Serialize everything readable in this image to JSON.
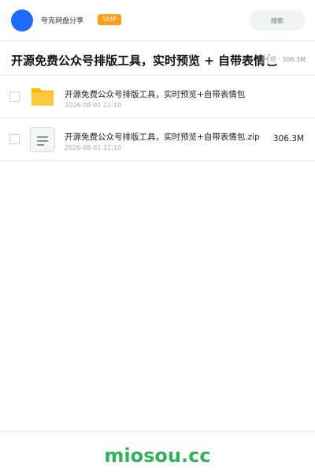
{
  "header": {
    "sharer_name": "夸克网盘分享",
    "badge": "SVIP",
    "search_placeholder": "搜索"
  },
  "share": {
    "title": "开源免费公众号排版工具，实时预览 + 自带表情包",
    "meta": "项 · 306.3M"
  },
  "files": [
    {
      "name": "开源免费公众号排版工具，实时预览+自带表情包",
      "date": "2026-08-01 22:10",
      "size": "",
      "icon": "folder-icon"
    },
    {
      "name": "开源免费公众号排版工具，实时预览+自带表情包.zip",
      "date": "2026-08-01 22:10",
      "size": "306.3M",
      "icon": "zip-file-icon"
    }
  ],
  "footer": {
    "brand": "miosou.cc"
  },
  "colors": {
    "accent_blue": "#1e6bff",
    "svip_orange": "#ff9c1a",
    "folder_yellow": "#ffc83d",
    "brand_green": "#33b05a"
  }
}
